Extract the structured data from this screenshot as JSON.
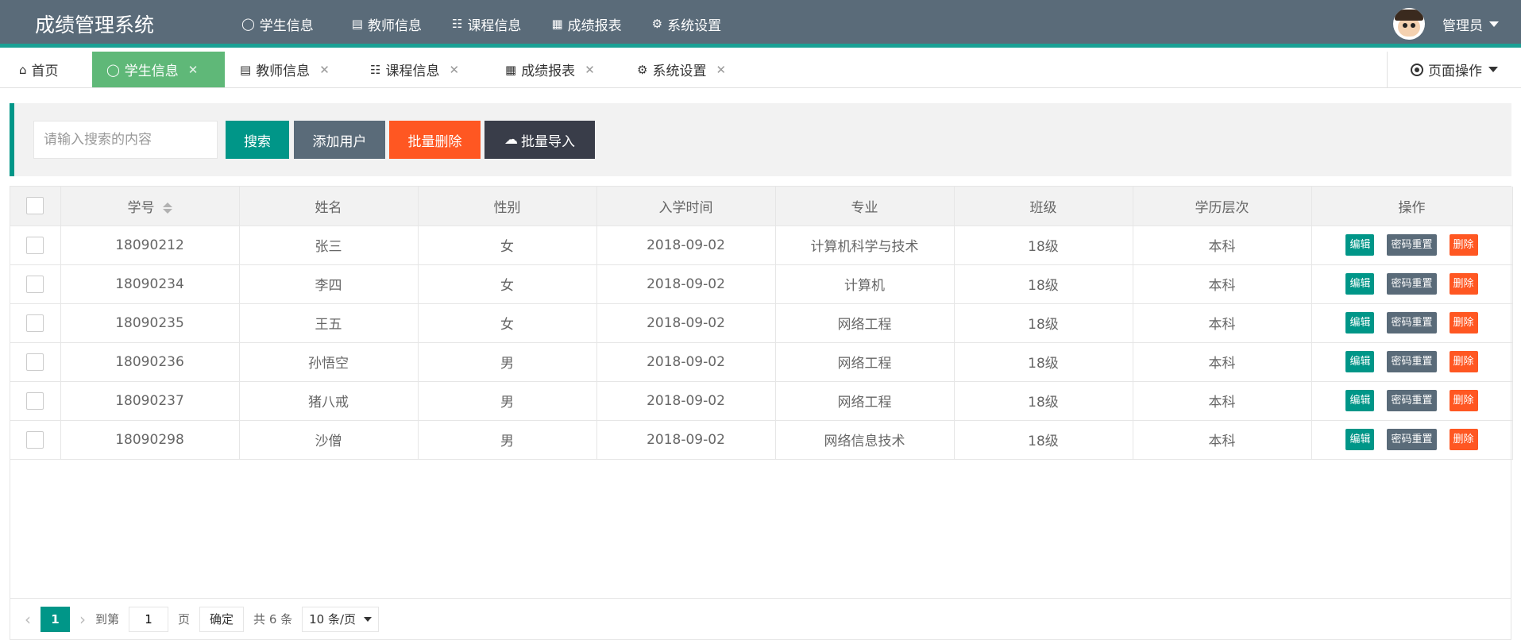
{
  "header": {
    "brand": "成绩管理系统",
    "nav": [
      {
        "label": "学生信息",
        "icon": "users-icon"
      },
      {
        "label": "教师信息",
        "icon": "clipboard-icon"
      },
      {
        "label": "课程信息",
        "icon": "book-icon"
      },
      {
        "label": "成绩报表",
        "icon": "table-icon"
      },
      {
        "label": "系统设置",
        "icon": "gear-icon"
      }
    ],
    "user": "管理员"
  },
  "tabs": {
    "home": "首页",
    "items": [
      "学生信息",
      "教师信息",
      "课程信息",
      "成绩报表",
      "系统设置"
    ],
    "page_ops": "页面操作"
  },
  "toolbar": {
    "search_placeholder": "请输入搜索的内容",
    "search": "搜索",
    "add_user": "添加用户",
    "batch_delete": "批量删除",
    "batch_import": "批量导入"
  },
  "colors": {
    "header_bg": "#5a6b79",
    "accent": "#1aa094",
    "active_green": "#5fb878",
    "primary": "#009688",
    "dark": "#393d49",
    "danger": "#ff5722",
    "gray_btn": "#5a6b79"
  },
  "table": {
    "columns": [
      "学号",
      "姓名",
      "性别",
      "入学时间",
      "专业",
      "班级",
      "学历层次",
      "操作"
    ],
    "rows": [
      {
        "id": "18090212",
        "name": "张三",
        "gender": "女",
        "date": "2018-09-02",
        "major": "计算机科学与技术",
        "class": "18级",
        "level": "本科"
      },
      {
        "id": "18090234",
        "name": "李四",
        "gender": "女",
        "date": "2018-09-02",
        "major": "计算机",
        "class": "18级",
        "level": "本科"
      },
      {
        "id": "18090235",
        "name": "王五",
        "gender": "女",
        "date": "2018-09-02",
        "major": "网络工程",
        "class": "18级",
        "level": "本科"
      },
      {
        "id": "18090236",
        "name": "孙悟空",
        "gender": "男",
        "date": "2018-09-02",
        "major": "网络工程",
        "class": "18级",
        "level": "本科"
      },
      {
        "id": "18090237",
        "name": "猪八戒",
        "gender": "男",
        "date": "2018-09-02",
        "major": "网络工程",
        "class": "18级",
        "level": "本科"
      },
      {
        "id": "18090298",
        "name": "沙僧",
        "gender": "男",
        "date": "2018-09-02",
        "major": "网络信息技术",
        "class": "18级",
        "level": "本科"
      }
    ],
    "actions": {
      "edit": "编辑",
      "reset": "密码重置",
      "delete": "删除"
    }
  },
  "pager": {
    "current": "1",
    "goto_label": "到第",
    "goto_value": "1",
    "page_unit": "页",
    "confirm": "确定",
    "total": "共 6 条",
    "page_size": "10 条/页"
  }
}
